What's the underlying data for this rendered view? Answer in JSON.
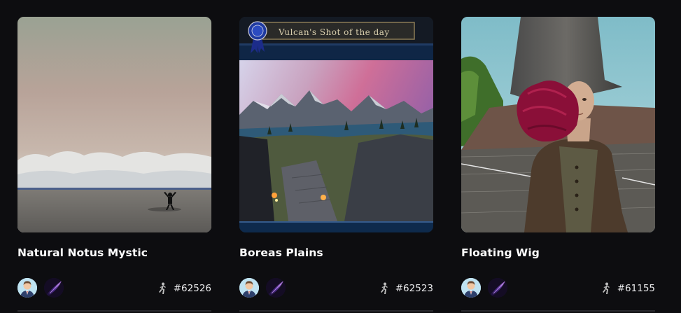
{
  "cards": [
    {
      "title": "Natural Notus Mystic",
      "token_id": "#62526",
      "user_avatar_icon": "user-avatar-icon",
      "collection_icon": "collection-avatar-icon",
      "type_icon": "running-figure-icon"
    },
    {
      "title": "Boreas Plains",
      "token_id": "#62523",
      "banner_text": "Vulcan's Shot of the day",
      "user_avatar_icon": "user-avatar-icon",
      "collection_icon": "collection-avatar-icon",
      "type_icon": "running-figure-icon"
    },
    {
      "title": "Floating Wig",
      "token_id": "#61155",
      "user_avatar_icon": "user-avatar-icon",
      "collection_icon": "collection-avatar-icon",
      "type_icon": "running-figure-icon"
    }
  ],
  "colors": {
    "background": "#0d0d10",
    "text": "#ffffff",
    "divider": "#2a2a2f"
  }
}
